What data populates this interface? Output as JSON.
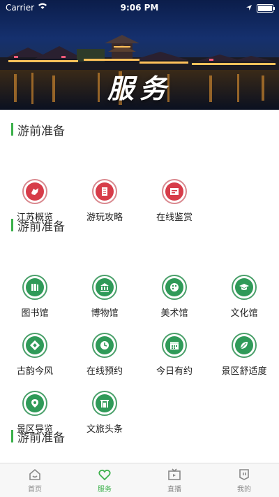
{
  "status": {
    "carrier": "Carrier",
    "time": "9:06 PM"
  },
  "hero": {
    "title": "服务"
  },
  "sections": [
    {
      "title": "游前准备",
      "items": [
        {
          "label": "江苏概览",
          "icon": "map-icon"
        },
        {
          "label": "游玩攻略",
          "icon": "guide-book-icon"
        },
        {
          "label": "在线鉴赏",
          "icon": "appreciation-icon"
        }
      ]
    },
    {
      "title": "游前准备",
      "items": [
        {
          "label": "图书馆",
          "icon": "library-icon"
        },
        {
          "label": "博物馆",
          "icon": "museum-icon"
        },
        {
          "label": "美术馆",
          "icon": "palette-icon"
        },
        {
          "label": "文化馆",
          "icon": "graduation-cap-icon"
        },
        {
          "label": "古韵今风",
          "icon": "culture-icon"
        },
        {
          "label": "在线预约",
          "icon": "clock-icon"
        },
        {
          "label": "今日有约",
          "icon": "calendar-icon"
        },
        {
          "label": "景区舒适度",
          "icon": "leaf-icon"
        },
        {
          "label": "景区导览",
          "icon": "location-pin-icon"
        },
        {
          "label": "文旅头条",
          "icon": "gate-icon"
        }
      ]
    },
    {
      "title": "游前准备"
    }
  ],
  "tabbar": [
    {
      "label": "首页",
      "icon": "home-icon"
    },
    {
      "label": "服务",
      "icon": "heart-icon",
      "active": true
    },
    {
      "label": "直播",
      "icon": "tv-icon"
    },
    {
      "label": "我的",
      "icon": "profile-icon"
    }
  ],
  "colors": {
    "accent": "#3bb04a",
    "red_icon": "#d73c49",
    "green_icon": "#2f9a58"
  }
}
